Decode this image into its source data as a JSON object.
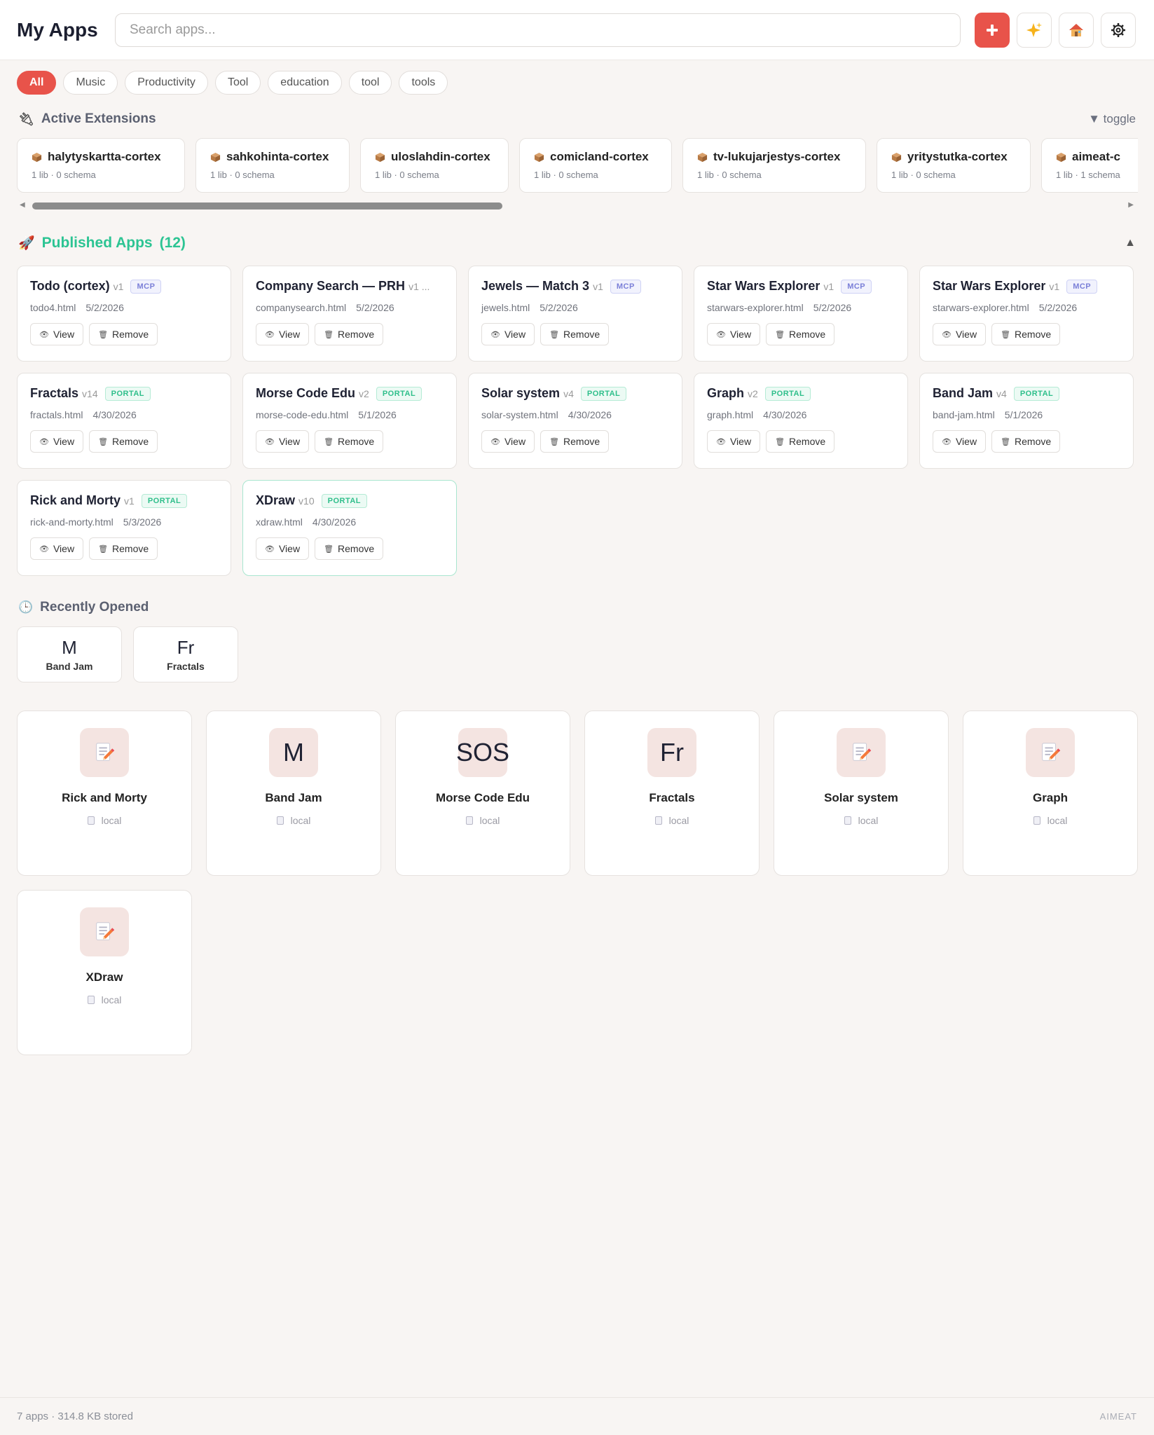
{
  "header": {
    "title": "My Apps",
    "search_placeholder": "Search apps...",
    "add_icon": "plus-icon",
    "sparkle_icon": "sparkle-icon",
    "home_icon": "house-icon",
    "settings_icon": "gear-icon",
    "accent_color": "#e8534a"
  },
  "filters": [
    "All",
    "Music",
    "Productivity",
    "Tool",
    "education",
    "tool",
    "tools"
  ],
  "extensions": {
    "heading": "Active Extensions",
    "toggle_label": "▼ toggle",
    "items": [
      {
        "name": "halytyskartta-cortex",
        "meta": "1 lib · 0 schema"
      },
      {
        "name": "sahkohinta-cortex",
        "meta": "1 lib · 0 schema"
      },
      {
        "name": "uloslahdin-cortex",
        "meta": "1 lib · 0 schema"
      },
      {
        "name": "comicland-cortex",
        "meta": "1 lib · 0 schema"
      },
      {
        "name": "tv-lukujarjestys-cortex",
        "meta": "1 lib · 0 schema"
      },
      {
        "name": "yritystutka-cortex",
        "meta": "1 lib · 0 schema"
      },
      {
        "name": "aimeat-c",
        "meta": "1 lib · 1 schema"
      }
    ]
  },
  "published": {
    "heading": "Published Apps",
    "count": "(12)",
    "accent_color": "#2cc493",
    "view_label": "View",
    "remove_label": "Remove",
    "apps": [
      {
        "name": "Todo (cortex)",
        "version": "v1",
        "badge": "MCP",
        "file": "todo4.html",
        "date": "5/2/2026"
      },
      {
        "name": "Company Search — PRH",
        "version": "v1 ...",
        "badge": "",
        "file": "companysearch.html",
        "date": "5/2/2026"
      },
      {
        "name": "Jewels — Match 3",
        "version": "v1",
        "badge": "MCP",
        "file": "jewels.html",
        "date": "5/2/2026"
      },
      {
        "name": "Star Wars Explorer",
        "version": "v1",
        "badge": "MCP",
        "file": "starwars-explorer.html",
        "date": "5/2/2026"
      },
      {
        "name": "Star Wars Explorer",
        "version": "v1",
        "badge": "MCP",
        "file": "starwars-explorer.html",
        "date": "5/2/2026"
      },
      {
        "name": "Fractals",
        "version": "v14",
        "badge": "PORTAL",
        "file": "fractals.html",
        "date": "4/30/2026"
      },
      {
        "name": "Morse Code Edu",
        "version": "v2",
        "badge": "PORTAL",
        "file": "morse-code-edu.html",
        "date": "5/1/2026"
      },
      {
        "name": "Solar system",
        "version": "v4",
        "badge": "PORTAL",
        "file": "solar-system.html",
        "date": "4/30/2026"
      },
      {
        "name": "Graph",
        "version": "v2",
        "badge": "PORTAL",
        "file": "graph.html",
        "date": "4/30/2026"
      },
      {
        "name": "Band Jam",
        "version": "v4",
        "badge": "PORTAL",
        "file": "band-jam.html",
        "date": "5/1/2026"
      },
      {
        "name": "Rick and Morty",
        "version": "v1",
        "badge": "PORTAL",
        "file": "rick-and-morty.html",
        "date": "5/3/2026"
      },
      {
        "name": "XDraw",
        "version": "v10",
        "badge": "PORTAL",
        "file": "xdraw.html",
        "date": "4/30/2026"
      }
    ]
  },
  "recent": {
    "heading": "Recently Opened",
    "items": [
      {
        "abbr": "M",
        "label": "Band Jam"
      },
      {
        "abbr": "Fr",
        "label": "Fractals"
      }
    ]
  },
  "apps": [
    {
      "icon": "memo-pencil-icon",
      "abbr": "",
      "name": "Rick and Morty",
      "source": "local"
    },
    {
      "icon": "",
      "abbr": "M",
      "name": "Band Jam",
      "source": "local"
    },
    {
      "icon": "",
      "abbr": "SOS",
      "name": "Morse Code Edu",
      "source": "local"
    },
    {
      "icon": "",
      "abbr": "Fr",
      "name": "Fractals",
      "source": "local"
    },
    {
      "icon": "memo-pencil-icon",
      "abbr": "",
      "name": "Solar system",
      "source": "local"
    },
    {
      "icon": "memo-pencil-icon",
      "abbr": "",
      "name": "Graph",
      "source": "local"
    },
    {
      "icon": "memo-pencil-icon",
      "abbr": "",
      "name": "XDraw",
      "source": "local"
    }
  ],
  "footer": {
    "stats": "7 apps · 314.8 KB stored",
    "brand": "AIMEAT"
  }
}
